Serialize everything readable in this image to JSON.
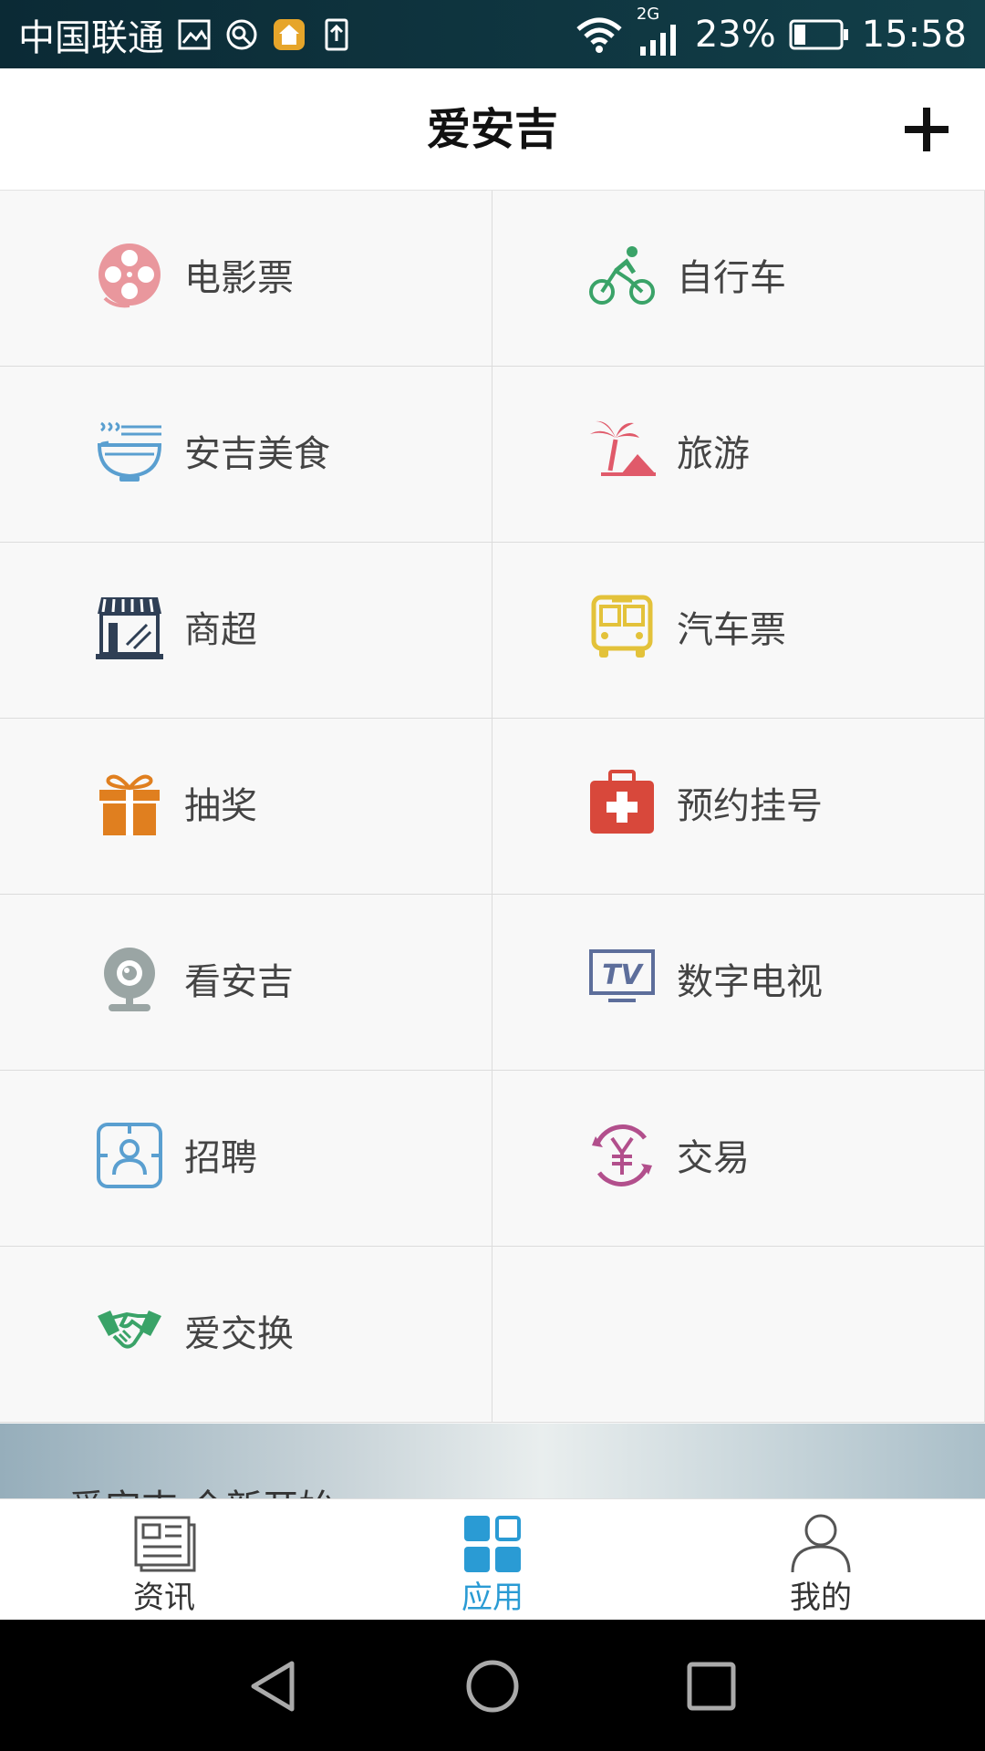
{
  "status_bar": {
    "carrier": "中国联通",
    "network": "2G",
    "battery": "23%",
    "time": "15:58"
  },
  "header": {
    "title": "爱安吉"
  },
  "apps": [
    {
      "label": "电影票",
      "icon": "film-reel-icon"
    },
    {
      "label": "自行车",
      "icon": "cyclist-icon"
    },
    {
      "label": "安吉美食",
      "icon": "noodle-bowl-icon"
    },
    {
      "label": "旅游",
      "icon": "palm-beach-icon"
    },
    {
      "label": "商超",
      "icon": "storefront-icon"
    },
    {
      "label": "汽车票",
      "icon": "bus-icon"
    },
    {
      "label": "抽奖",
      "icon": "gift-icon"
    },
    {
      "label": "预约挂号",
      "icon": "medical-kit-icon"
    },
    {
      "label": "看安吉",
      "icon": "webcam-icon"
    },
    {
      "label": "数字电视",
      "icon": "tv-icon"
    },
    {
      "label": "招聘",
      "icon": "id-badge-icon"
    },
    {
      "label": "交易",
      "icon": "yuan-exchange-icon"
    },
    {
      "label": "爱交换",
      "icon": "handshake-icon"
    }
  ],
  "banner": {
    "text": "爱安吉 全新开始"
  },
  "tabs": [
    {
      "label": "资讯",
      "active": false
    },
    {
      "label": "应用",
      "active": true
    },
    {
      "label": "我的",
      "active": false
    }
  ],
  "colors": {
    "accent": "#2a9bd4",
    "statusbar": "#0f3540"
  }
}
